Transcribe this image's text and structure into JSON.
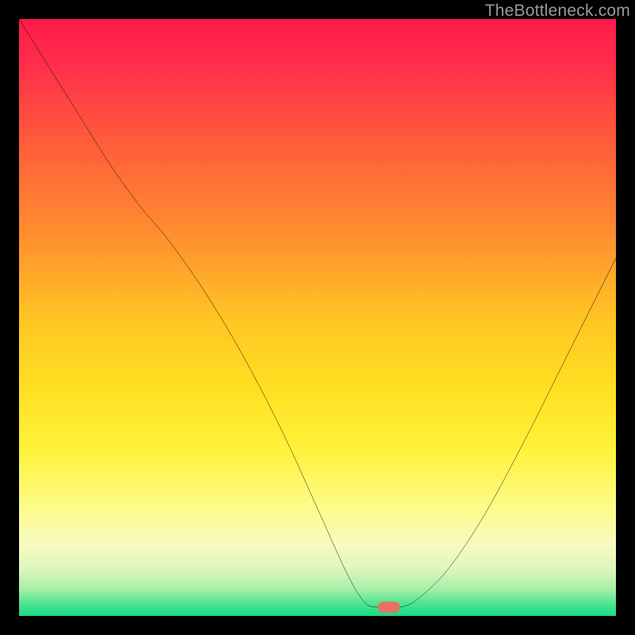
{
  "watermark": "TheBottleneck.com",
  "marker": {
    "x_frac": 0.62,
    "y_frac": 0.985,
    "color": "#e57368"
  },
  "gradient_stops": [
    {
      "offset": 0.0,
      "color": "#ff1a4a"
    },
    {
      "offset": 0.08,
      "color": "#ff2f4a"
    },
    {
      "offset": 0.2,
      "color": "#ff5a3a"
    },
    {
      "offset": 0.35,
      "color": "#ff8a2f"
    },
    {
      "offset": 0.5,
      "color": "#ffc424"
    },
    {
      "offset": 0.62,
      "color": "#ffe022"
    },
    {
      "offset": 0.72,
      "color": "#fff23a"
    },
    {
      "offset": 0.82,
      "color": "#fdfb8a"
    },
    {
      "offset": 0.88,
      "color": "#f6fbc0"
    },
    {
      "offset": 0.92,
      "color": "#dff7bc"
    },
    {
      "offset": 0.955,
      "color": "#a6f0a8"
    },
    {
      "offset": 0.98,
      "color": "#4de38f"
    },
    {
      "offset": 1.0,
      "color": "#18db85"
    }
  ],
  "chart_data": {
    "type": "line",
    "title": "",
    "xlabel": "",
    "ylabel": "",
    "xlim": [
      0,
      1
    ],
    "ylim": [
      0,
      1
    ],
    "note": "x is normalized horizontal position across the gradient panel; y is normalized vertical position (0 = top, 1 = bottom). Curve is the black V-shaped line; marker is the red pill at the minimum.",
    "series": [
      {
        "name": "bottleneck-curve",
        "x": [
          0.0,
          0.05,
          0.1,
          0.15,
          0.2,
          0.25,
          0.3,
          0.35,
          0.4,
          0.45,
          0.5,
          0.55,
          0.58,
          0.605,
          0.64,
          0.67,
          0.72,
          0.78,
          0.85,
          0.92,
          1.0
        ],
        "y": [
          0.0,
          0.08,
          0.16,
          0.24,
          0.31,
          0.37,
          0.44,
          0.52,
          0.61,
          0.71,
          0.82,
          0.93,
          0.978,
          0.985,
          0.985,
          0.97,
          0.92,
          0.83,
          0.7,
          0.56,
          0.4
        ]
      }
    ],
    "annotations": [
      {
        "name": "optimal-marker",
        "x": 0.62,
        "y": 0.985
      }
    ]
  }
}
